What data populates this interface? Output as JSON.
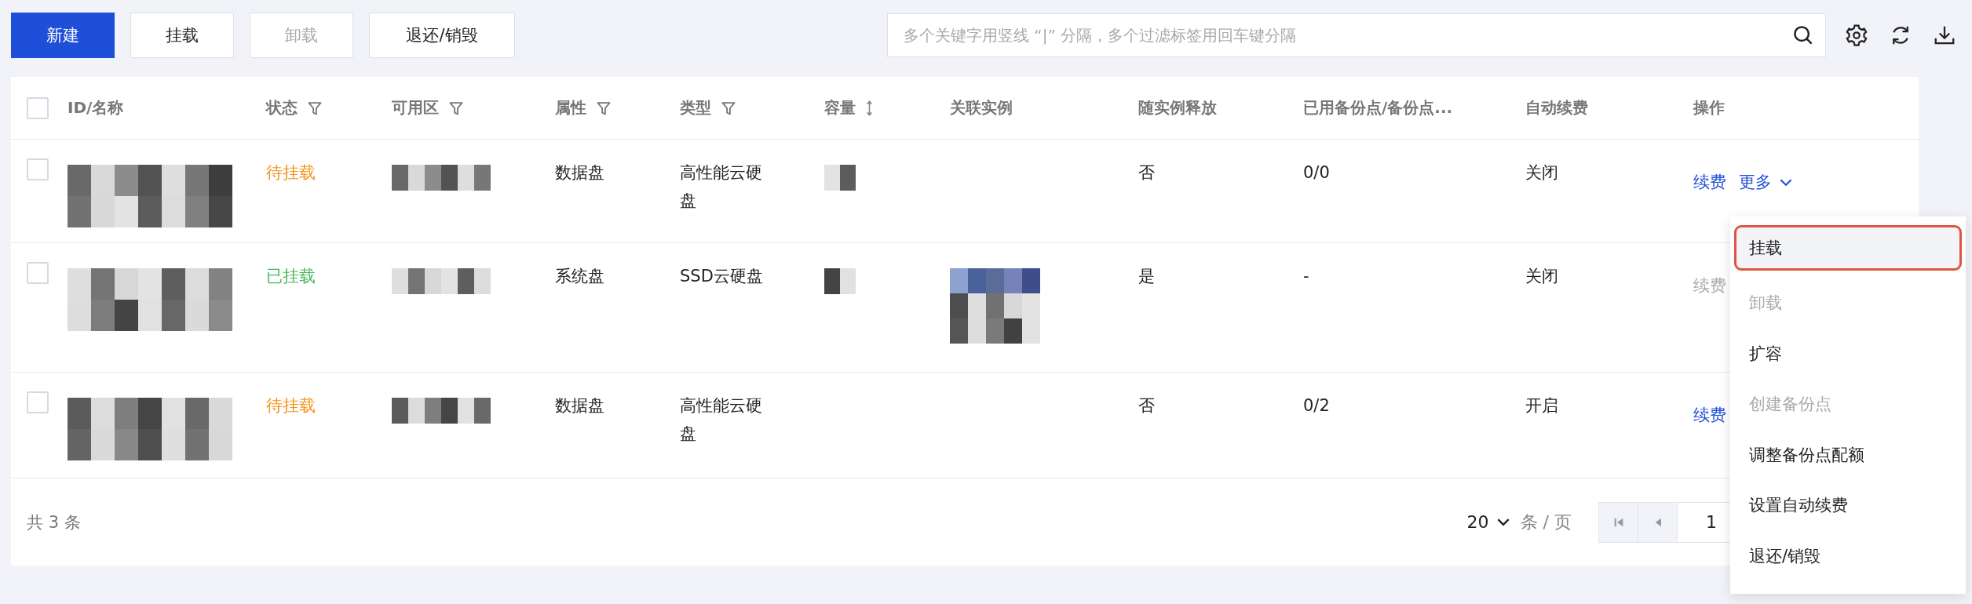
{
  "toolbar": {
    "buttons": [
      {
        "label": "新建",
        "kind": "primary",
        "disabled": false
      },
      {
        "label": "挂载",
        "kind": "default",
        "disabled": false
      },
      {
        "label": "卸载",
        "kind": "default",
        "disabled": true
      },
      {
        "label": "退还/销毁",
        "kind": "default",
        "disabled": false
      }
    ],
    "search": {
      "placeholder": "多个关键字用竖线 “|” 分隔，多个过滤标签用回车键分隔"
    }
  },
  "table": {
    "header_checked": false,
    "columns": [
      {
        "label": "ID/名称",
        "kind": "plain"
      },
      {
        "label": "状态",
        "kind": "filterable"
      },
      {
        "label": "可用区",
        "kind": "filterable"
      },
      {
        "label": "属性",
        "kind": "filterable"
      },
      {
        "label": "类型",
        "kind": "filterable"
      },
      {
        "label": "容量",
        "kind": "sortable"
      },
      {
        "label": "关联实例",
        "kind": "plain"
      },
      {
        "label": "随实例释放",
        "kind": "plain"
      },
      {
        "label": "已用备份点/备份点...",
        "kind": "plain"
      },
      {
        "label": "自动续费",
        "kind": "plain"
      },
      {
        "label": "操作",
        "kind": "plain"
      }
    ],
    "rows": [
      {
        "checked": false,
        "name": {
          "kind": "picture"
        },
        "status": {
          "text": "待挂载",
          "color": "#f5921b"
        },
        "zone": {
          "kind": "picture"
        },
        "attribute": "数据盘",
        "type": "高性能云硬盘",
        "capacity": {
          "kind": "picture"
        },
        "release": "否",
        "backups": "0/0",
        "auto_renew": "关闭",
        "actions": [
          {
            "label": "续费",
            "kind": "link",
            "disabled": false
          },
          {
            "label": "更多",
            "kind": "dropdown",
            "disabled": false
          }
        ]
      },
      {
        "checked": false,
        "name": {
          "kind": "picture"
        },
        "status": {
          "text": "已挂载",
          "color": "#4cb85a"
        },
        "zone": {
          "kind": "picture"
        },
        "attribute": "系统盘",
        "type": "SSD云硬盘",
        "capacity": {
          "kind": "picture"
        },
        "instance": {
          "kind": "picture"
        },
        "release": "是",
        "backups": "-",
        "auto_renew": "关闭",
        "actions": [
          {
            "label": "续费",
            "kind": "link",
            "disabled": true
          }
        ]
      },
      {
        "checked": false,
        "name": {
          "kind": "picture"
        },
        "status": {
          "text": "待挂载",
          "color": "#f5921b"
        },
        "zone": {
          "kind": "picture"
        },
        "attribute": "数据盘",
        "type": "高性能云硬盘",
        "release": "否",
        "backups": "0/2",
        "auto_renew": "开启",
        "actions": [
          {
            "label": "续费",
            "kind": "link",
            "disabled": false
          }
        ]
      }
    ]
  },
  "footer": {
    "total": "共 3 条",
    "page_size": "20",
    "page_size_unit": "条 / 页",
    "page": "1"
  },
  "menu": {
    "items": [
      {
        "label": "挂载",
        "disabled": false,
        "selected": true
      },
      {
        "label": "卸载",
        "disabled": true,
        "selected": false
      },
      {
        "label": "扩容",
        "disabled": false,
        "selected": false
      },
      {
        "label": "创建备份点",
        "disabled": true,
        "selected": false
      },
      {
        "label": "调整备份点配额",
        "disabled": false,
        "selected": false
      },
      {
        "label": "设置自动续费",
        "disabled": false,
        "selected": false
      },
      {
        "label": "退还/销毁",
        "disabled": false,
        "selected": false
      }
    ]
  }
}
